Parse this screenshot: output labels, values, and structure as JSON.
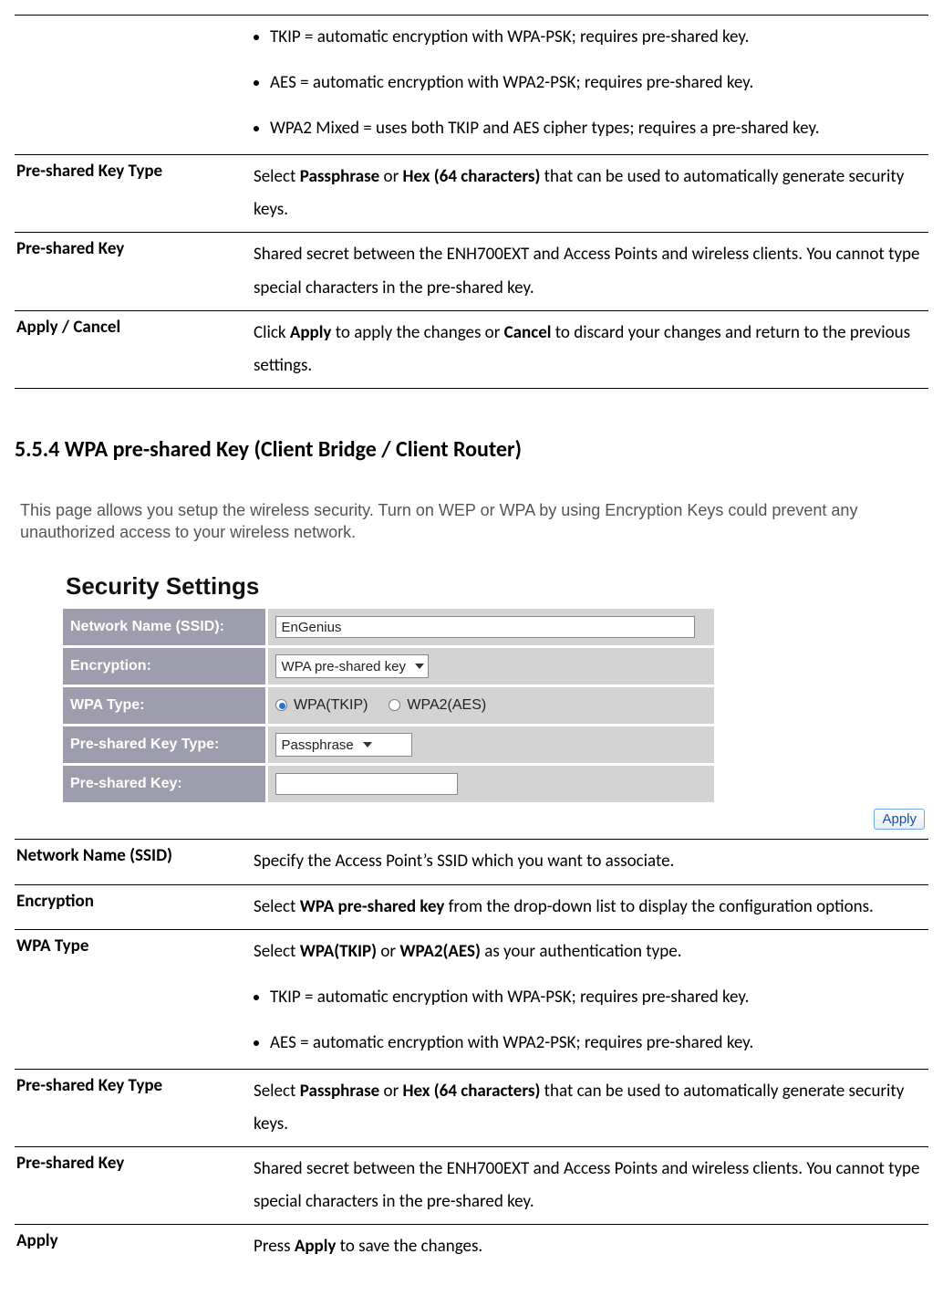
{
  "table1": {
    "bullets": [
      "TKIP = automatic encryption with WPA-PSK; requires pre-shared key.",
      "AES = automatic encryption with WPA2-PSK; requires pre-shared key.",
      "WPA2 Mixed = uses both TKIP and AES cipher types; requires a pre-shared key."
    ],
    "rows": [
      {
        "label": "Pre-shared Key Type",
        "desc_parts": [
          "Select ",
          "Passphrase",
          " or ",
          "Hex (64 characters)",
          " that can be used to automatically generate security keys."
        ],
        "bold_idx": [
          1,
          3
        ]
      },
      {
        "label": "Pre-shared Key",
        "desc_parts": [
          "Shared secret between the ENH700EXT and Access Points and wireless clients. You cannot type special characters in the pre-shared key."
        ],
        "bold_idx": []
      },
      {
        "label": "Apply / Cancel",
        "desc_parts": [
          "Click ",
          "Apply",
          " to apply the changes or ",
          "Cancel",
          " to discard your changes and return to the previous settings."
        ],
        "bold_idx": [
          1,
          3
        ]
      }
    ]
  },
  "section_heading": "5.5.4 WPA pre-shared Key (Client Bridge / Client Router)",
  "shot": {
    "intro": "This page allows you setup the wireless security. Turn on WEP or WPA by using Encryption Keys could prevent any unauthorized access to your wireless network.",
    "title": "Security Settings",
    "rows": {
      "ssid_label": "Network Name (SSID):",
      "ssid_value": "EnGenius",
      "enc_label": "Encryption:",
      "enc_value": "WPA pre-shared key",
      "wpatype_label": "WPA Type:",
      "wpatype_opt1": "WPA(TKIP)",
      "wpatype_opt2": "WPA2(AES)",
      "psktype_label": "Pre-shared Key Type:",
      "psktype_value": "Passphrase",
      "psk_label": "Pre-shared Key:",
      "psk_value": ""
    },
    "apply_label": "Apply"
  },
  "table2": {
    "rows": [
      {
        "label": "Network Name (SSID)",
        "desc_parts": [
          "Specify the Access Point’s SSID which you want to associate."
        ],
        "bold_idx": []
      },
      {
        "label": "Encryption",
        "desc_parts": [
          "Select ",
          "WPA pre-shared key",
          " from the drop-down list to display the configuration options."
        ],
        "bold_idx": [
          1
        ]
      },
      {
        "label": "WPA Type",
        "desc_parts": [
          "Select ",
          "WPA(TKIP)",
          " or ",
          "WPA2(AES)",
          " as your authentication type."
        ],
        "bold_idx": [
          1,
          3
        ],
        "bullets": [
          "TKIP = automatic encryption with WPA-PSK; requires pre-shared key.",
          "AES = automatic encryption with WPA2-PSK; requires pre-shared key."
        ]
      },
      {
        "label": "Pre-shared Key Type",
        "desc_parts": [
          "Select ",
          "Passphrase",
          " or ",
          "Hex (64 characters)",
          " that can be used to automatically generate security keys."
        ],
        "bold_idx": [
          1,
          3
        ]
      },
      {
        "label": "Pre-shared Key",
        "desc_parts": [
          "Shared secret between the ENH700EXT and Access Points and wireless clients. You cannot type special characters in the pre-shared key."
        ],
        "bold_idx": []
      },
      {
        "label": "Apply",
        "desc_parts": [
          "Press ",
          "Apply",
          " to save the changes."
        ],
        "bold_idx": [
          1
        ]
      }
    ]
  }
}
